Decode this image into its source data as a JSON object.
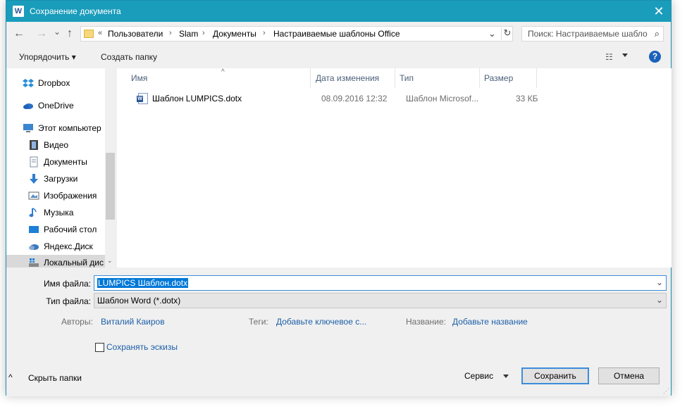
{
  "window": {
    "title": "Сохранение документа",
    "app_icon": "W",
    "close_glyph": "✕"
  },
  "nav": {
    "back_glyph": "←",
    "forward_glyph": "→",
    "dropdown_glyph": "⌄",
    "up_glyph": "↑",
    "breadcrumb_prefix": "«",
    "breadcrumbs": [
      "Пользователи",
      "Slam",
      "Документы",
      "Настраиваемые шаблоны Office"
    ],
    "breadcrumb_sep": "›",
    "addr_chevron": "⌄",
    "refresh_glyph": "↻",
    "search_placeholder": "Поиск: Настраиваемые шабло",
    "search_glyph": "⌕"
  },
  "toolbar": {
    "organize": "Упорядочить ▾",
    "new_folder": "Создать папку",
    "view_glyph": "☷",
    "help_glyph": "?"
  },
  "sidebar": {
    "items": [
      {
        "label": "Dropbox",
        "icon": "dropbox-icon",
        "selected": false
      },
      {
        "label": "OneDrive",
        "icon": "onedrive-icon",
        "selected": false
      },
      {
        "label": "Этот компьютер",
        "icon": "computer-icon",
        "selected": false
      },
      {
        "label": "Видео",
        "icon": "video-icon",
        "selected": false
      },
      {
        "label": "Документы",
        "icon": "documents-icon",
        "selected": false
      },
      {
        "label": "Загрузки",
        "icon": "downloads-icon",
        "selected": false
      },
      {
        "label": "Изображения",
        "icon": "pictures-icon",
        "selected": false
      },
      {
        "label": "Музыка",
        "icon": "music-icon",
        "selected": false
      },
      {
        "label": "Рабочий стол",
        "icon": "desktop-icon",
        "selected": false
      },
      {
        "label": "Яндекс.Диск",
        "icon": "yandex-disk-icon",
        "selected": false
      },
      {
        "label": "Локальный дис",
        "icon": "local-disk-icon",
        "selected": true
      }
    ],
    "scroll_down_glyph": "⌄"
  },
  "files": {
    "sort_glyph": "^",
    "columns": [
      "Имя",
      "Дата изменения",
      "Тип",
      "Размер"
    ],
    "rows": [
      {
        "name": "Шаблон LUMPICS.dotx",
        "date": "08.09.2016 12:32",
        "type": "Шаблон Microsof...",
        "size": "33 КБ"
      }
    ]
  },
  "form": {
    "filename_label": "Имя файла:",
    "filename_value": "LUMPICS Шаблон.dotx",
    "filetype_label": "Тип файла:",
    "filetype_value": "Шаблон Word (*.dotx)",
    "dd_glyph": "⌄",
    "authors_label": "Авторы:",
    "authors_value": "Виталий Каиров",
    "tags_label": "Теги:",
    "tags_value": "Добавьте ключевое с...",
    "title_label": "Название:",
    "title_value": "Добавьте название",
    "thumbnails_label": "Сохранять эскизы",
    "thumbnails_checked": false
  },
  "footer": {
    "hide_folders": "Скрыть папки",
    "hide_glyph": "^",
    "service": "Сервис",
    "save": "Сохранить",
    "cancel": "Отмена"
  },
  "colors": {
    "titlebar": "#1a9cbb",
    "link": "#1c5fa8",
    "accent": "#0078d7"
  }
}
